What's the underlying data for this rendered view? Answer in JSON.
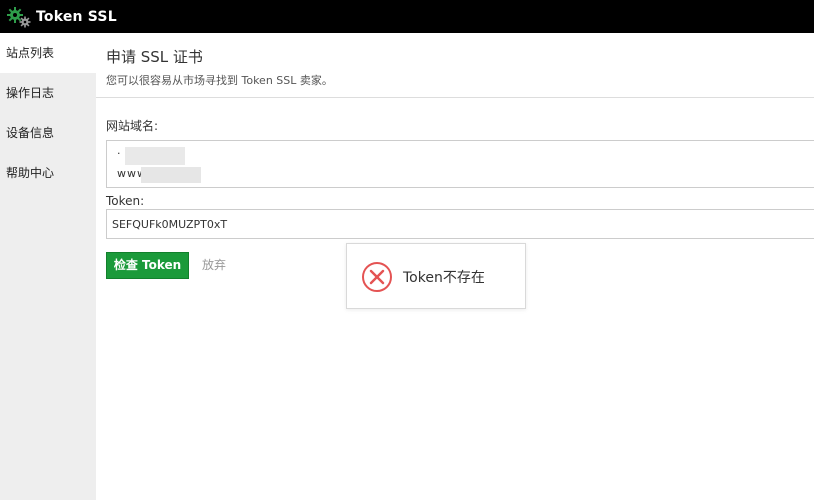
{
  "app": {
    "title": "Token SSL",
    "logo_icon": "gears-icon",
    "accent_color": "#1b9a3a"
  },
  "sidebar": {
    "items": [
      {
        "label": "站点列表",
        "active": true
      },
      {
        "label": "操作日志",
        "active": false
      },
      {
        "label": "设备信息",
        "active": false
      },
      {
        "label": "帮助中心",
        "active": false
      }
    ]
  },
  "page": {
    "title": "申请 SSL 证书",
    "subtitle": "您可以很容易从市场寻找到 Token SSL 卖家。"
  },
  "form": {
    "domain_label": "网站域名:",
    "domain_line1": "·",
    "domain_line2": "www.        .n",
    "token_label": "Token:",
    "token_value": "SEFQUFk0MUZPT0xT",
    "check_button": "检查 Token",
    "cancel_button": "放弃"
  },
  "toast": {
    "icon": "error-circle-icon",
    "message": "Token不存在",
    "icon_color": "#e45353"
  }
}
